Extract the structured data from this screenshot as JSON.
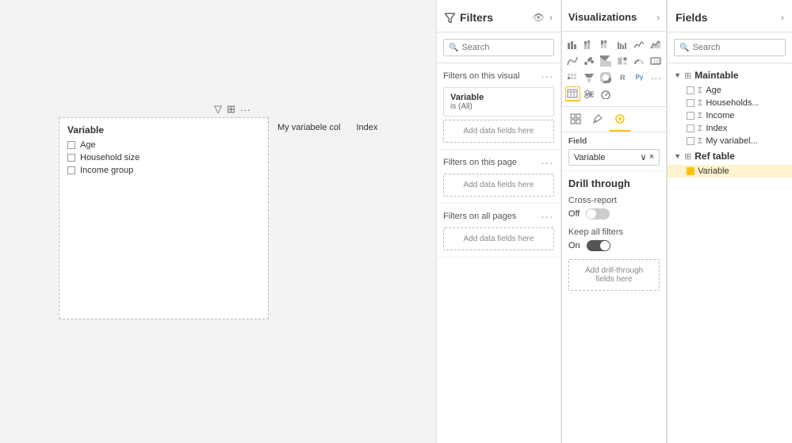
{
  "canvas": {
    "toolbar": {
      "filter_icon": "▽",
      "table_icon": "⊞",
      "more_icon": "···"
    },
    "visual": {
      "title": "Variable",
      "items": [
        "Age",
        "Household size",
        "Income group"
      ]
    },
    "column_headers": [
      "My variabele col",
      "Index"
    ]
  },
  "filters": {
    "title": "Filters",
    "search_placeholder": "Search",
    "sections": [
      {
        "label": "Filters on this visual",
        "card": {
          "title": "Variable",
          "sub": "is (All)"
        },
        "add_label": "Add data fields here"
      },
      {
        "label": "Filters on this page",
        "add_label": "Add data fields here"
      },
      {
        "label": "Filters on all pages",
        "add_label": "Add data fields here"
      }
    ]
  },
  "visualizations": {
    "title": "Visualizations",
    "tabs": [
      {
        "id": "build",
        "icon": "⊞",
        "active": true
      },
      {
        "id": "format",
        "icon": "🖌"
      },
      {
        "id": "analytics",
        "icon": "🔍"
      }
    ],
    "icons_rows": [
      [
        "▬▬",
        "📊",
        "▦",
        "📈",
        "📉",
        "▤"
      ],
      [
        "〰",
        "🔷",
        "◫",
        "🎛",
        "📋",
        "▦"
      ],
      [
        "🔲",
        "▦",
        "⊙",
        "🔄",
        "🐍",
        "𝙋𝒚"
      ],
      [
        "▦",
        "▣",
        "⋯",
        "🔗",
        "⬜",
        "•••"
      ]
    ],
    "field_section": {
      "label": "Field",
      "dropdown_value": "Variable",
      "dropdown_expand": "∨",
      "dropdown_clear": "×"
    },
    "drill_through": {
      "title": "Drill through",
      "cross_report": {
        "label": "Cross-report",
        "toggle_state": "off",
        "toggle_label": "Off"
      },
      "keep_all_filters": {
        "label": "Keep all filters",
        "toggle_state": "on",
        "toggle_label": "On"
      },
      "add_label": "Add drill-through fields here"
    }
  },
  "fields": {
    "title": "Fields",
    "search_placeholder": "Search",
    "tables": [
      {
        "name": "Maintable",
        "icon": "⊞",
        "expanded": true,
        "fields": [
          {
            "name": "Age",
            "checked": false,
            "type": "Σ"
          },
          {
            "name": "Households...",
            "checked": false,
            "type": "Σ"
          },
          {
            "name": "Income",
            "checked": false,
            "type": "Σ"
          },
          {
            "name": "Index",
            "checked": false,
            "type": "Σ"
          },
          {
            "name": "My variabel...",
            "checked": false,
            "type": "Σ"
          }
        ]
      },
      {
        "name": "Ref table",
        "icon": "⊞",
        "expanded": true,
        "fields": [
          {
            "name": "Variable",
            "checked": true,
            "type": ""
          }
        ]
      }
    ]
  }
}
